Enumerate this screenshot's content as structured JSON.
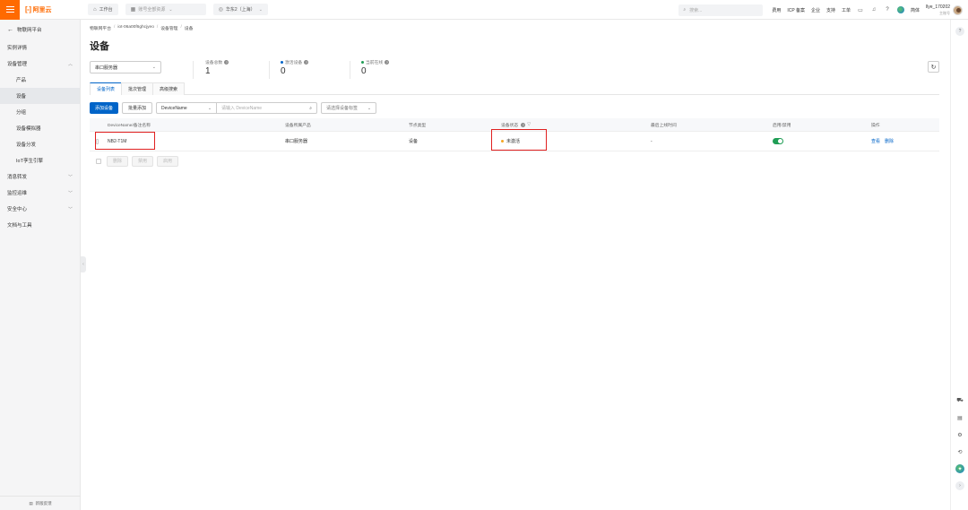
{
  "topbar": {
    "logo_text": "阿里云",
    "workbench": "工作台",
    "account_menu": "账号全部资源",
    "region": "华东2（上海）",
    "search_placeholder": "搜索...",
    "links": [
      "费用",
      "ICP 备案",
      "企业",
      "支持",
      "工单"
    ],
    "lang": "简体",
    "user_name": "llye_170202",
    "user_sub": "主账号",
    "brand_color": "#ff6a00"
  },
  "sidebar": {
    "header": "物联网平台",
    "items": [
      {
        "label": "实例详情",
        "type": "top"
      },
      {
        "label": "设备管理",
        "type": "group",
        "expanded": true
      },
      {
        "label": "产品",
        "type": "sub"
      },
      {
        "label": "设备",
        "type": "sub",
        "active": true
      },
      {
        "label": "分组",
        "type": "sub"
      },
      {
        "label": "设备模拟器",
        "type": "sub"
      },
      {
        "label": "设备分发",
        "type": "sub"
      },
      {
        "label": "IoT孪生引擎",
        "type": "sub"
      },
      {
        "label": "消息转发",
        "type": "group",
        "expanded": false
      },
      {
        "label": "监控运维",
        "type": "group",
        "expanded": false
      },
      {
        "label": "安全中心",
        "type": "group",
        "expanded": false
      },
      {
        "label": "文档与工具",
        "type": "top"
      }
    ],
    "footer": "新版反馈"
  },
  "breadcrumb": [
    "物联网平台",
    "iot-06a00f6ghcjyeo",
    "设备管理",
    "设备"
  ],
  "page_title": "设备",
  "product_select": "串口服务器",
  "stats": [
    {
      "label": "设备总数",
      "value": "1",
      "dot_color": null
    },
    {
      "label": "激活设备",
      "value": "0",
      "dot_color": "#0064c8"
    },
    {
      "label": "当前在线",
      "value": "0",
      "dot_color": "#1f9d55"
    }
  ],
  "tabs": [
    {
      "label": "设备列表",
      "active": true
    },
    {
      "label": "批次管理",
      "active": false
    },
    {
      "label": "高级搜索",
      "active": false
    }
  ],
  "toolbar": {
    "add_device": "添加设备",
    "batch_add": "批量添加",
    "filter_field": "DeviceName",
    "filter_placeholder": "请输入 DeviceName",
    "tag_placeholder": "请选择设备标签"
  },
  "table": {
    "columns": [
      "DeviceName/备注名称",
      "设备所属产品",
      "节点类型",
      "设备状态",
      "最后上线时间",
      "启用/禁用",
      "操作"
    ],
    "rows": [
      {
        "device_name": "NB2-T1M",
        "product": "串口服务器",
        "node_type": "设备",
        "status": "未激活",
        "status_color": "#f5a623",
        "last_online": "-",
        "enabled": true,
        "actions": [
          "查看",
          "删除"
        ]
      }
    ]
  },
  "bulk_actions": [
    "删除",
    "禁用",
    "启用"
  ]
}
